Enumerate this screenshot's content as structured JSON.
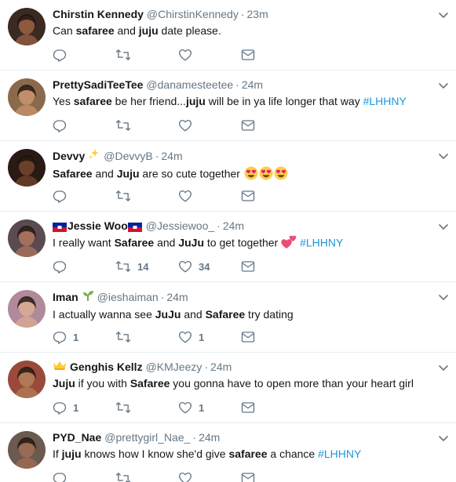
{
  "tweets": [
    {
      "name": "Chirstin Kennedy",
      "handle": "@ChirstinKennedy",
      "time": "23m",
      "segments": [
        {
          "t": "Can ",
          "b": false
        },
        {
          "t": "safaree",
          "b": true
        },
        {
          "t": " and ",
          "b": false
        },
        {
          "t": "juju",
          "b": true
        },
        {
          "t": " date please.",
          "b": false
        }
      ],
      "replies": "",
      "retweets": "",
      "likes": "",
      "avatar_color": "#3a2a22"
    },
    {
      "name": "PrettySadiTeeTee",
      "handle": "@danamesteetee",
      "time": "24m",
      "segments": [
        {
          "t": "Yes ",
          "b": false
        },
        {
          "t": "safaree",
          "b": true
        },
        {
          "t": " be her friend...",
          "b": false
        },
        {
          "t": "juju",
          "b": true
        },
        {
          "t": " will be in ya life longer that way ",
          "b": false
        },
        {
          "t": "#LHHNY",
          "h": true
        }
      ],
      "replies": "",
      "retweets": "",
      "likes": "",
      "avatar_color": "#8a6a4a"
    },
    {
      "name": "Devvy",
      "name_emoji": "sparkles",
      "handle": "@DevvyB",
      "time": "24m",
      "segments": [
        {
          "t": "Safaree",
          "b": true
        },
        {
          "t": " and ",
          "b": false
        },
        {
          "t": "Juju",
          "b": true
        },
        {
          "t": " are so cute together ",
          "b": false
        }
      ],
      "trailing_emoji": [
        "heart-eyes",
        "heart-eyes",
        "heart-eyes"
      ],
      "replies": "",
      "retweets": "",
      "likes": "",
      "avatar_color": "#2a1a14"
    },
    {
      "name": "Jessie Woo",
      "name_flags": true,
      "handle": "@Jessiewoo_",
      "time": "24m",
      "segments": [
        {
          "t": "I really want ",
          "b": false
        },
        {
          "t": "Safaree",
          "b": true
        },
        {
          "t": " and ",
          "b": false
        },
        {
          "t": "JuJu",
          "b": true
        },
        {
          "t": " to get together ",
          "b": false
        }
      ],
      "inline_emoji": "two-hearts",
      "tail": "#LHHNY",
      "replies": "",
      "retweets": "14",
      "likes": "34",
      "avatar_color": "#5a4a52"
    },
    {
      "name": "Iman",
      "name_emoji": "seedling",
      "handle": "@ieshaiman",
      "time": "24m",
      "segments": [
        {
          "t": "I actually wanna see ",
          "b": false
        },
        {
          "t": "JuJu",
          "b": true
        },
        {
          "t": " and ",
          "b": false
        },
        {
          "t": "Safaree",
          "b": true
        },
        {
          "t": " try dating",
          "b": false
        }
      ],
      "replies": "1",
      "retweets": "",
      "likes": "1",
      "avatar_color": "#b08a9a"
    },
    {
      "name": "Genghis Kellz",
      "name_prefix_emoji": "crown",
      "handle": "@KMJeezy",
      "time": "24m",
      "segments": [
        {
          "t": "Juju",
          "b": true
        },
        {
          "t": " if you with ",
          "b": false
        },
        {
          "t": "Safaree",
          "b": true
        },
        {
          "t": " you gonna have to open more than your heart girl",
          "b": false
        }
      ],
      "replies": "1",
      "retweets": "",
      "likes": "1",
      "avatar_color": "#9a4a3a"
    },
    {
      "name": "PYD_Nae",
      "handle": "@prettygirl_Nae_",
      "time": "24m",
      "segments": [
        {
          "t": "If ",
          "b": false
        },
        {
          "t": "juju",
          "b": true
        },
        {
          "t": " knows how I know she'd give ",
          "b": false
        },
        {
          "t": "safaree",
          "b": true
        },
        {
          "t": " a chance ",
          "b": false
        },
        {
          "t": "#LHHNY",
          "h": true
        }
      ],
      "replies": "",
      "retweets": "",
      "likes": "",
      "avatar_color": "#6a5a50"
    }
  ],
  "colors": {
    "accent": "#1b95e0",
    "muted": "#657786",
    "divider": "#e6ecf0"
  },
  "icons": {
    "reply": "reply-icon",
    "retweet": "retweet-icon",
    "like": "heart-icon",
    "dm": "envelope-icon",
    "caret": "chevron-down-icon"
  }
}
